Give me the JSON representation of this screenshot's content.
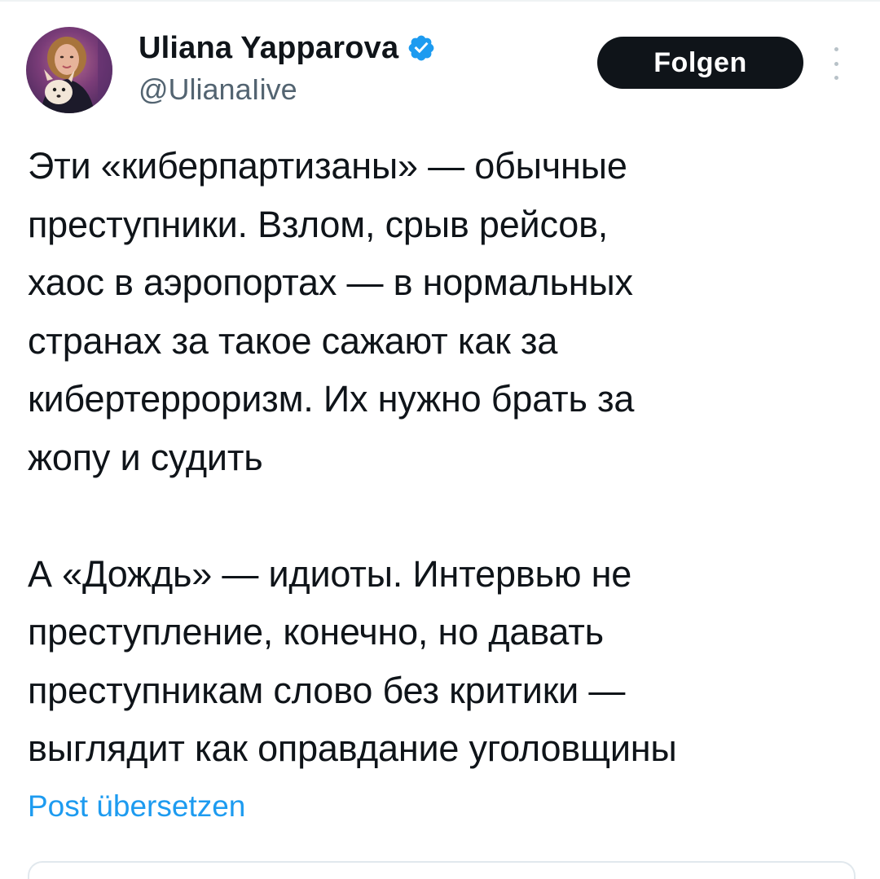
{
  "author": {
    "display_name": "Uliana Yapparova",
    "handle": "@UlianaIive",
    "verified": true,
    "avatar_icon": "profile-photo-woman-with-dog"
  },
  "actions": {
    "follow_label": "Folgen",
    "more_icon": "more-dots-icon"
  },
  "tweet": {
    "paragraphs": [
      {
        "lines": [
          "Эти «киберпартизаны» — обычные",
          "преступники. Взлом, срыв рейсов,",
          "хаос в аэропортах — в нормальных",
          "странах за такое сажают как за",
          "кибертерроризм. Их нужно брать за",
          "жопу и судить"
        ]
      },
      {
        "lines": [
          "А «Дождь» — идиоты. Интервью не",
          "преступление, конечно, но давать",
          "преступникам слово без критики —",
          "выглядит как оправдание уголовщины"
        ]
      }
    ],
    "translate_label": "Post übersetzen"
  },
  "colors": {
    "text": "#0f1419",
    "secondary": "#536471",
    "link": "#1d9bf0",
    "verified": "#1d9bf0",
    "button_bg": "#0f1419",
    "button_text": "#ffffff"
  }
}
